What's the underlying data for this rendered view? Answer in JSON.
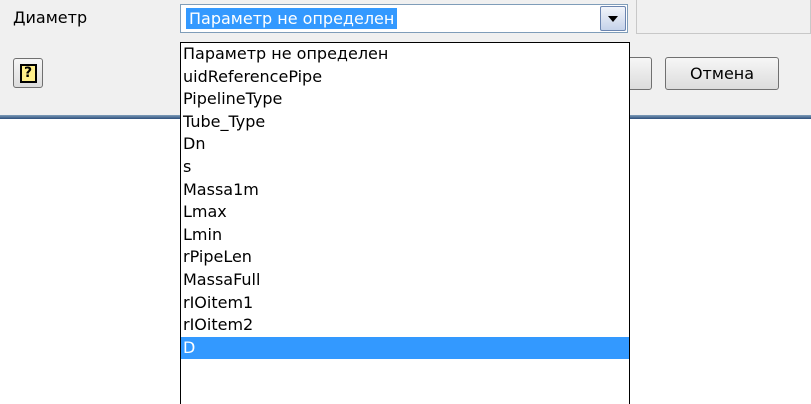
{
  "field": {
    "label": "Диаметр",
    "value": "Параметр не определен"
  },
  "buttons": {
    "help_label": "?",
    "cancel_label": "Отмена"
  },
  "dropdown": {
    "options": [
      "Параметр не определен",
      "uidReferencePipe",
      "PipelineType",
      "Tube_Type",
      "Dn",
      "s",
      "Massa1m",
      "Lmax",
      "Lmin",
      "rPipeLen",
      "MassaFull",
      "rIOitem1",
      "rIOitem2",
      "D"
    ],
    "highlighted": "D"
  },
  "colors": {
    "selection": "#3399ff",
    "dialog_background": "#f0f0f0"
  }
}
